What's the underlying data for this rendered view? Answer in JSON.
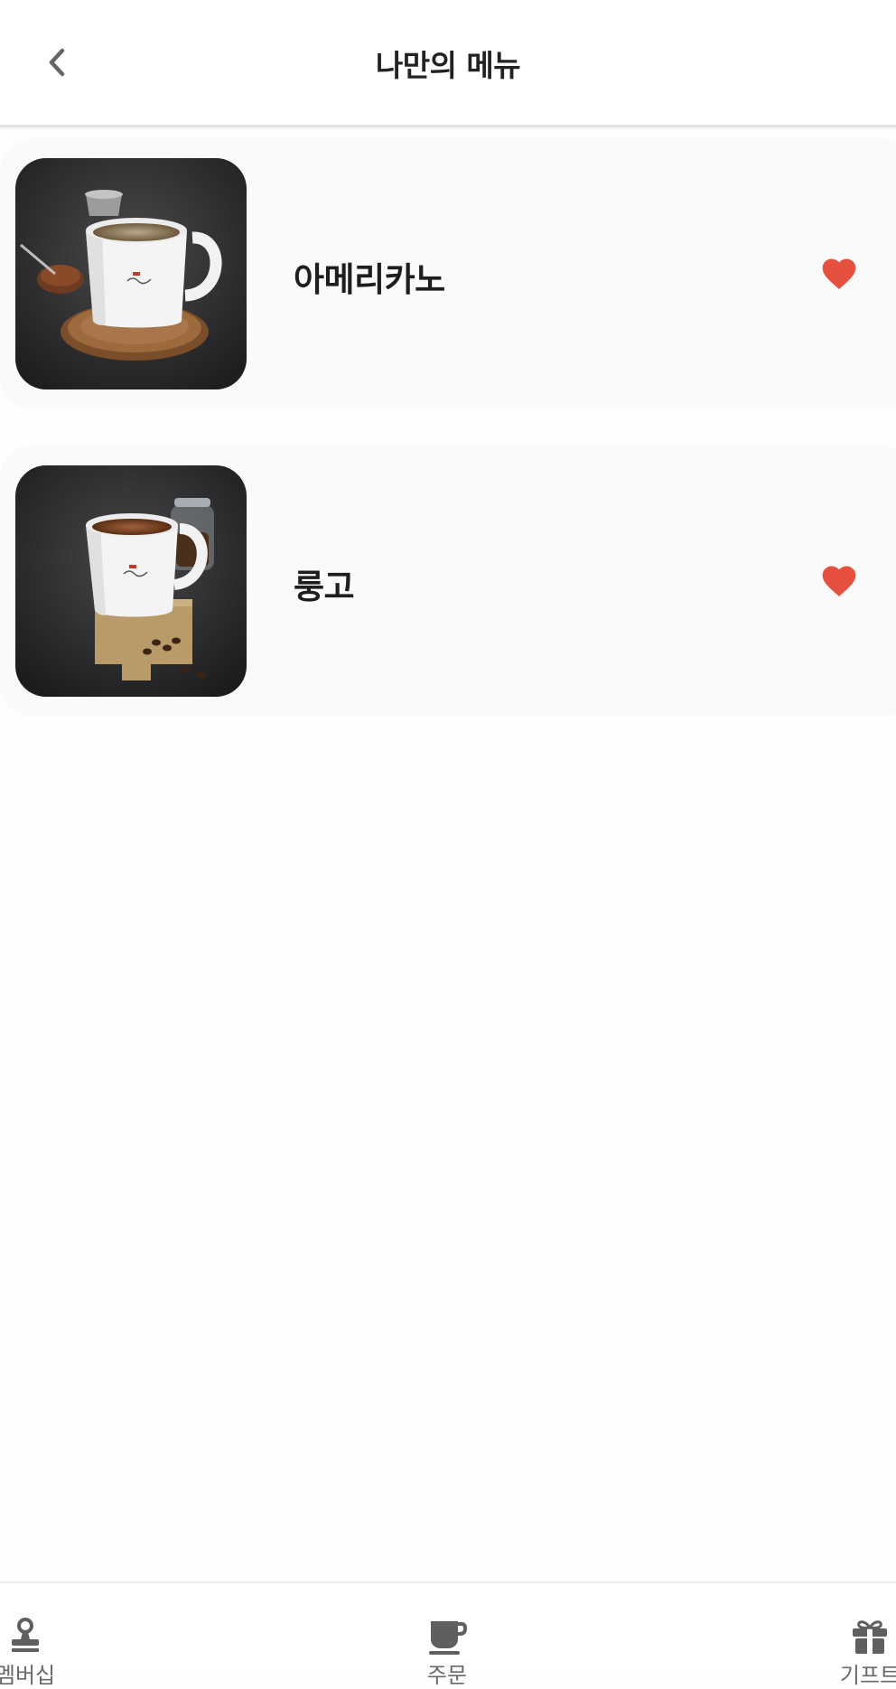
{
  "header": {
    "title": "나만의 메뉴"
  },
  "menu_items": [
    {
      "name": "아메리카노",
      "favorited": true
    },
    {
      "name": "룽고",
      "favorited": true
    }
  ],
  "tab_bar": {
    "tabs": [
      {
        "label": "멤버십",
        "icon": "stamp-icon"
      },
      {
        "label": "주문",
        "icon": "coffee-cup-icon"
      },
      {
        "label": "기프트",
        "icon": "gift-icon"
      }
    ]
  },
  "colors": {
    "heart": "#e5513e",
    "card_background": "#fafafa",
    "tab_icon": "#5f5f5f"
  }
}
